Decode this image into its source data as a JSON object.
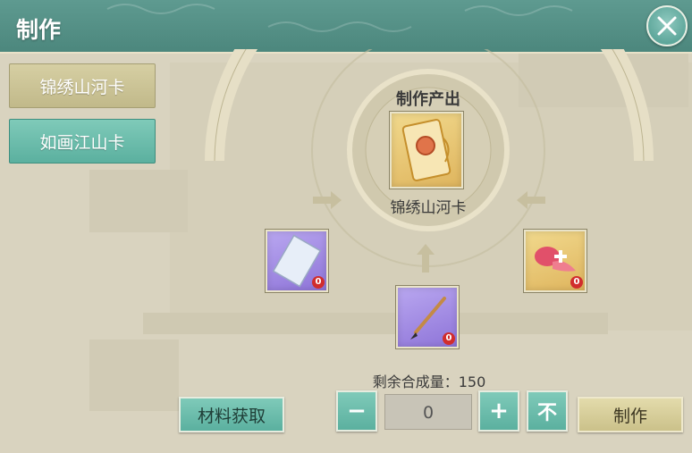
{
  "window": {
    "title": "制作"
  },
  "sidebar": {
    "items": [
      {
        "label": "锦绣山河卡",
        "selected": true
      },
      {
        "label": "如画江山卡",
        "selected": false
      }
    ]
  },
  "crafting": {
    "output_label": "制作产出",
    "output_name": "锦绣山河卡",
    "materials": [
      {
        "icon": "paper-icon",
        "count": "0"
      },
      {
        "icon": "brush-icon",
        "count": "0"
      },
      {
        "icon": "silk-ribbon-icon",
        "count": "0"
      }
    ],
    "remaining_label": "剩余合成量：150",
    "quantity_value": "0"
  },
  "controls": {
    "minus_label": "−",
    "plus_label": "+",
    "max_label": "不",
    "materials_button_label": "材料获取",
    "make_button_label": "制作"
  },
  "colors": {
    "title_bar": "#4c877d",
    "teal_button": "#5bb09f",
    "gold_button": "#c1b98a",
    "badge_red": "#d12d2d"
  }
}
